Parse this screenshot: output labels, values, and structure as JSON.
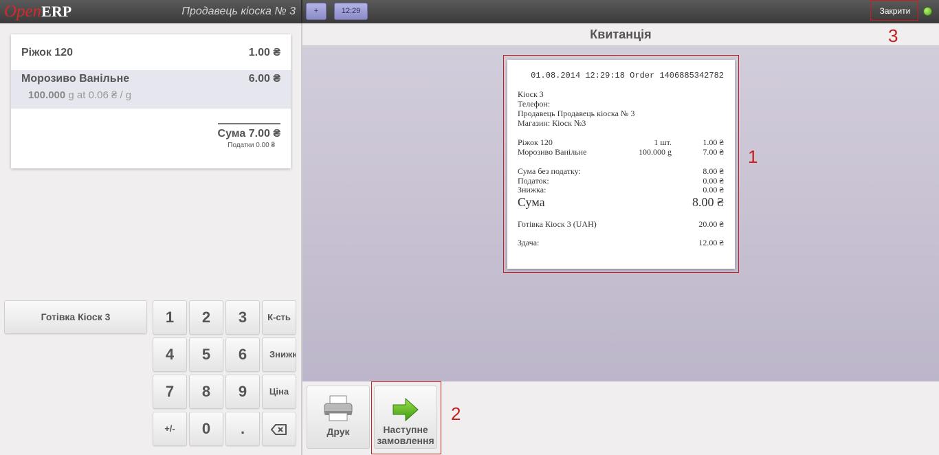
{
  "header": {
    "logo_open": "Open",
    "logo_erp": "ERP",
    "cashier": "Продавець кіоска № 3",
    "add_order_label": "+",
    "order_tab_label": "12:29",
    "close_label": "Закрити"
  },
  "order": {
    "lines": [
      {
        "name": "Ріжок 120",
        "price": "1.00 ₴"
      },
      {
        "name": "Морозиво Ванільне",
        "price": "6.00 ₴",
        "qty": "100.000",
        "unit_info": "g at 0.06 ₴ / g"
      }
    ],
    "total": "Сума 7.00 ₴",
    "tax": "Податки 0.00 ₴"
  },
  "paymethods": [
    "Готівка Кіоск 3"
  ],
  "keypad": {
    "digits": [
      "1",
      "2",
      "3",
      "4",
      "5",
      "6",
      "7",
      "8",
      "9",
      "+/-",
      "0",
      "."
    ],
    "modes": [
      "К-сть",
      "Знижка",
      "Ціна"
    ],
    "backspace_icon": "backspace-icon"
  },
  "screen": {
    "title": "Квитанція"
  },
  "receipt": {
    "header": "01.08.2014 12:29:18 Order 1406885342782",
    "shop_lines": [
      "Кіоск 3",
      "Телефон:",
      "Продавець Продавець кіоска № 3",
      "Магазин: Кіоск №3"
    ],
    "items": [
      {
        "name": "Ріжок 120",
        "qty": "1 шт.",
        "price": "1.00 ₴"
      },
      {
        "name": "Морозиво Ванільне",
        "qty": "100.000 g",
        "price": "7.00 ₴"
      }
    ],
    "subtotal_label": "Сума без податку:",
    "subtotal": "8.00 ₴",
    "tax_label": "Податок:",
    "tax": "0.00 ₴",
    "discount_label": "Знижка:",
    "discount": "0.00 ₴",
    "total_label": "Сума",
    "total": "8.00 ₴",
    "payment_label": "Готівка Кіоск 3 (UAH)",
    "payment": "20.00 ₴",
    "change_label": "Здача:",
    "change": "12.00 ₴"
  },
  "actions": {
    "print_label": "Друк",
    "next_label_1": "Наступне",
    "next_label_2": "замовлення"
  },
  "annotations": [
    "1",
    "2",
    "3"
  ],
  "colors": {
    "annotation_red": "#c81e1e",
    "topbar": "#4a4a4a",
    "status_ok": "#6cc22a"
  }
}
